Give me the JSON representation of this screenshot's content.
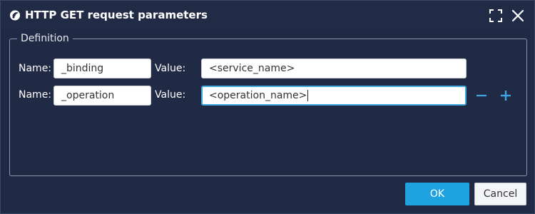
{
  "dialog": {
    "title": "HTTP GET request parameters",
    "title_icon": "app-logo-icon",
    "maximize_icon": "maximize-icon",
    "close_icon": "close-icon"
  },
  "definition": {
    "legend": "Definition",
    "name_label": "Name:",
    "value_label": "Value:",
    "rows": [
      {
        "name": "_binding",
        "value": "<service_name>"
      },
      {
        "name": "_operation",
        "value": "<operation_name>"
      }
    ],
    "remove_icon": "minus-icon",
    "add_icon": "plus-icon"
  },
  "buttons": {
    "ok": "OK",
    "cancel": "Cancel"
  },
  "colors": {
    "background": "#212a45",
    "accent": "#1fa3e0"
  }
}
